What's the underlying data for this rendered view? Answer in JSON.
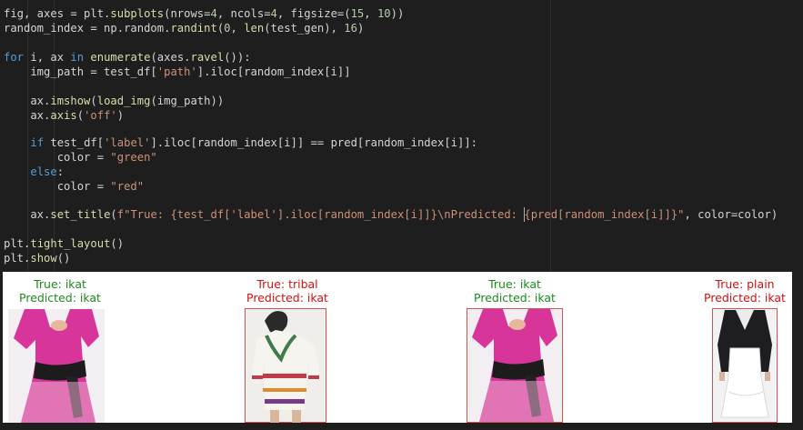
{
  "code": {
    "lines": [
      "fig, axes = plt.subplots(nrows=4, ncols=4, figsize=(15, 10))",
      "random_index = np.random.randint(0, len(test_gen), 16)",
      "",
      "for i, ax in enumerate(axes.ravel()):",
      "    img_path = test_df['path'].iloc[random_index[i]]",
      "",
      "    ax.imshow(load_img(img_path))",
      "    ax.axis('off')",
      "",
      "    if test_df['label'].iloc[random_index[i]] == pred[random_index[i]]:",
      "        color = \"green\"",
      "    else:",
      "        color = \"red\"",
      "",
      "    ax.set_title(f\"True: {test_df['label'].iloc[random_index[i]]}\\nPredicted: {pred[random_index[i]]}\", color=color)",
      "",
      "plt.tight_layout()",
      "plt.show()"
    ]
  },
  "output": {
    "tiles": [
      {
        "true_label": "True: ikat",
        "pred_label": "Predicted: ikat",
        "color": "#1a8a1a",
        "image": "pink-dress-with-black-sash"
      },
      {
        "true_label": "True: tribal",
        "pred_label": "Predicted: ikat",
        "color": "#d01010",
        "image": "white-embroidered-tunic"
      },
      {
        "true_label": "True: ikat",
        "pred_label": "Predicted: ikat",
        "color": "#1a8a1a",
        "image": "pink-dress-with-black-sash"
      },
      {
        "true_label": "True: plain",
        "pred_label": "Predicted: ikat",
        "color": "#d01010",
        "image": "black-jacket-white-dress"
      }
    ]
  }
}
